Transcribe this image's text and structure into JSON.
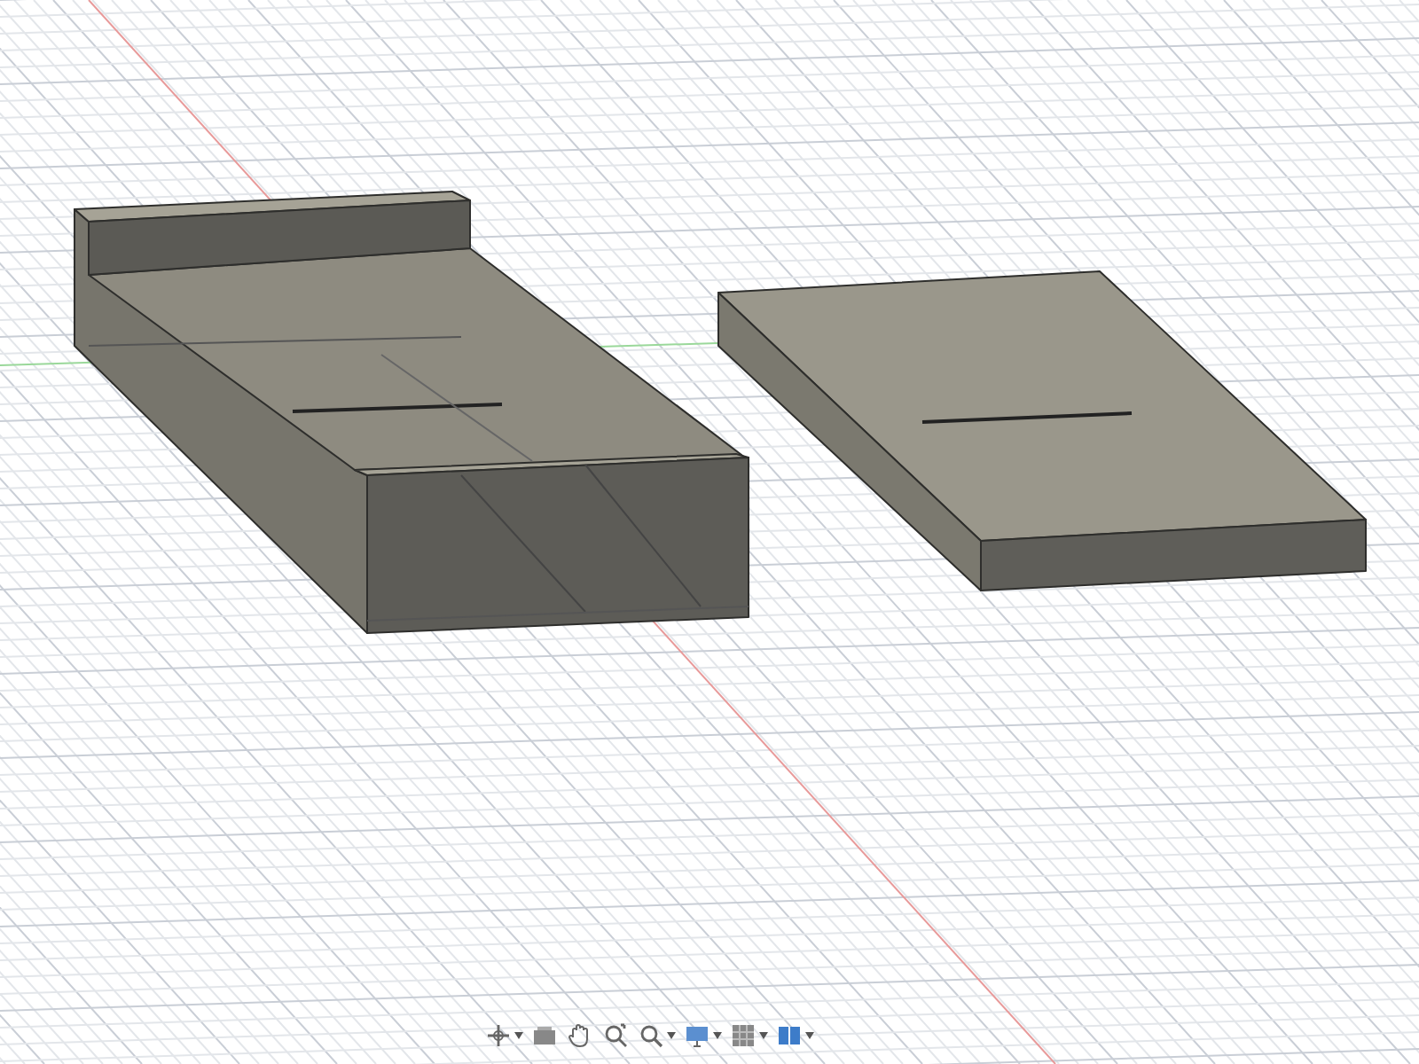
{
  "viewport": {
    "toolbar": [
      {
        "kind": "orbit",
        "dropdown": true
      },
      {
        "kind": "look",
        "dropdown": false
      },
      {
        "kind": "pan",
        "dropdown": false
      },
      {
        "kind": "fit",
        "dropdown": false
      },
      {
        "kind": "zoom",
        "dropdown": true
      },
      {
        "kind": "display",
        "dropdown": true
      },
      {
        "kind": "grid",
        "dropdown": true
      },
      {
        "kind": "views",
        "dropdown": true
      }
    ]
  }
}
